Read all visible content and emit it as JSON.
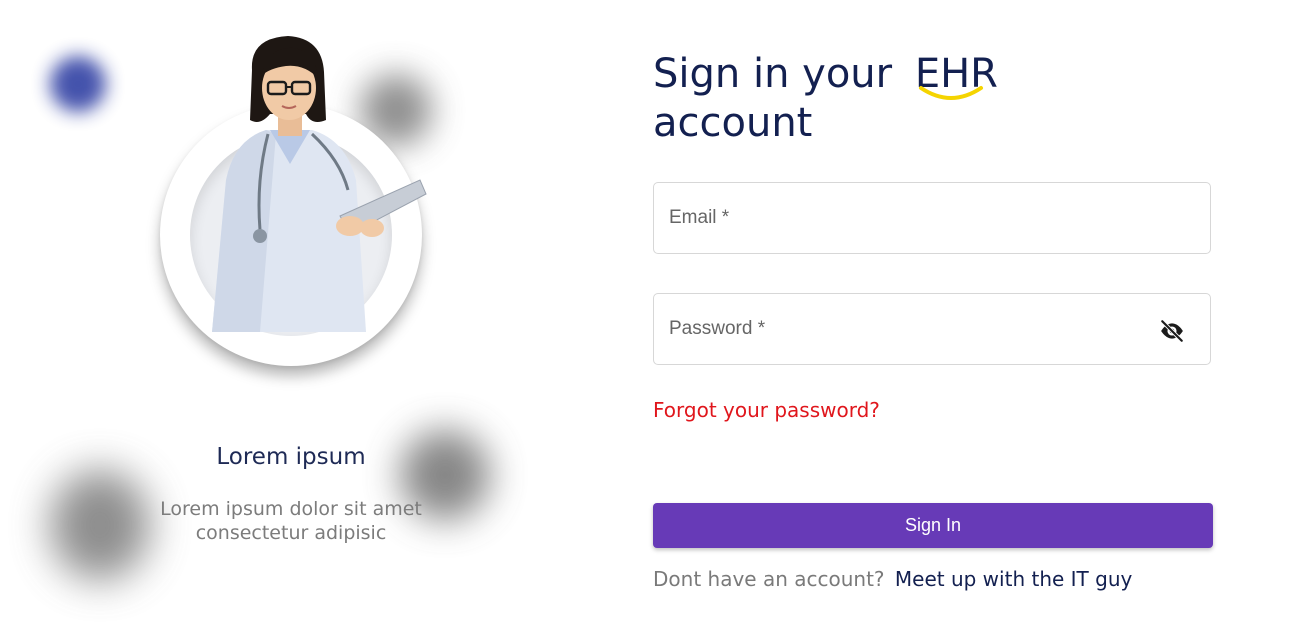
{
  "hero": {
    "title": "Lorem ipsum",
    "subtitle_line1": "Lorem ipsum dolor sit amet",
    "subtitle_line2": "consectetur adipisic"
  },
  "login": {
    "title_part1": "Sign in your",
    "title_highlight": "EHR",
    "title_part2": "account",
    "email_placeholder": "Email *",
    "password_placeholder": "Password *",
    "password_visibility_icon": "eye-off-icon",
    "forgot_link": "Forgot your password?",
    "signin_button": "Sign In",
    "signup_prompt": "Dont have an account?",
    "signup_link": "Meet up with the IT guy"
  },
  "colors": {
    "primary": "#673ab7",
    "title": "#132050",
    "link_error": "#e0161c",
    "accent": "#f5d400"
  }
}
